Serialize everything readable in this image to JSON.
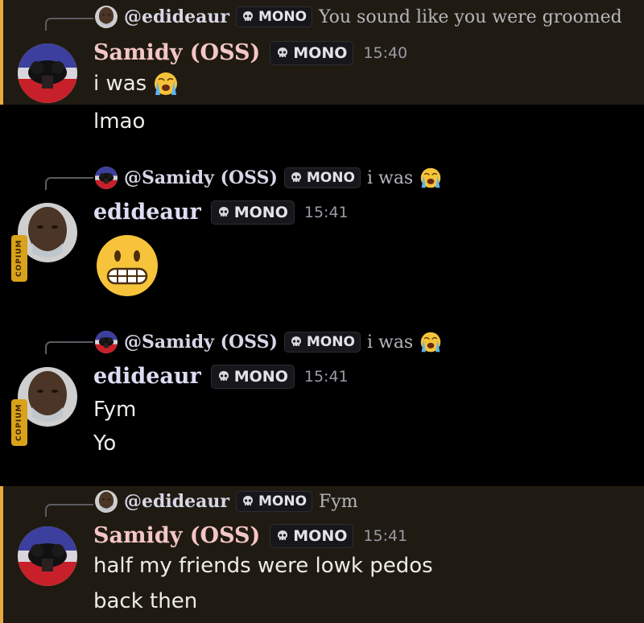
{
  "messages": [
    {
      "reply": {
        "name": "@edideaur",
        "tag": "MONO",
        "text": "You sound like you were groomed"
      },
      "author": "Samidy (OSS)",
      "tag": "MONO",
      "time": "15:40",
      "lines": [
        "i was",
        "lmao"
      ],
      "emoji": "loudly-crying-face"
    },
    {
      "reply": {
        "name": "@Samidy (OSS)",
        "tag": "MONO",
        "text": "i was"
      },
      "author": "edideaur",
      "tag": "MONO",
      "time": "15:41",
      "emoji": "grimacing-face",
      "badge": "COPIUM"
    },
    {
      "reply": {
        "name": "@Samidy (OSS)",
        "tag": "MONO",
        "text": "i was"
      },
      "author": "edideaur",
      "tag": "MONO",
      "time": "15:41",
      "lines": [
        "Fym",
        "Yo"
      ],
      "badge": "COPIUM"
    },
    {
      "reply": {
        "name": "@edideaur",
        "tag": "MONO",
        "text": "Fym"
      },
      "author": "Samidy (OSS)",
      "tag": "MONO",
      "time": "15:41",
      "lines": [
        "half my friends were lowk pedos",
        "back then"
      ]
    }
  ],
  "colors": {
    "highlight_bg": "#201b12",
    "highlight_bar": "#e8a93f",
    "samidy_name": "#f4c6c6",
    "edideaur_name": "#dcdcf2"
  }
}
